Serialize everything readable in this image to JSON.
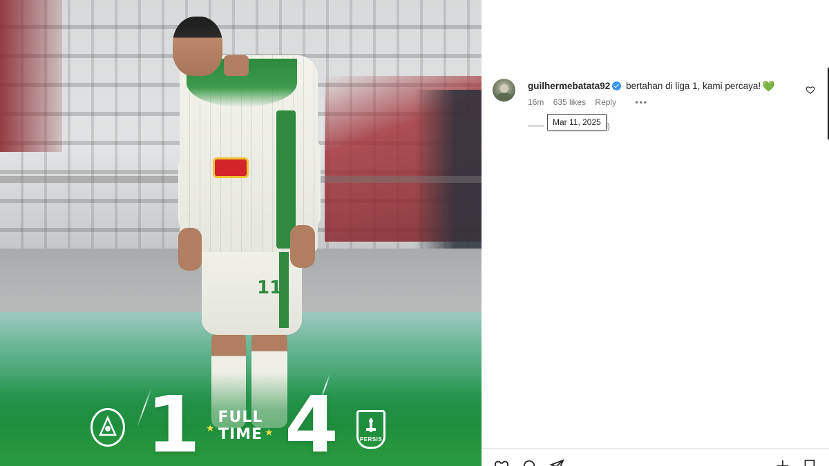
{
  "photo": {
    "score": {
      "home": "1",
      "away": "4",
      "status_line1": "FULL",
      "status_line2": "TIME"
    },
    "away_crest_label": "PERSIS",
    "player_number": "11"
  },
  "comment": {
    "username": "guilhermebatata92",
    "text": "bertahan di liga 1, kami percaya!",
    "emoji": "💚",
    "time_ago": "16m",
    "likes": "635 likes",
    "reply_label": "Reply",
    "more_label": "•••",
    "view_replies_count": "129)",
    "tooltip_date": "Mar 11, 2025"
  },
  "colors": {
    "verified": "#3897f0",
    "pitch_green": "#1c8b3f",
    "text_primary": "#262626",
    "text_secondary": "#737373"
  },
  "icons": {
    "comment_like": "heart-outline-icon",
    "actions": [
      "heart-outline-icon",
      "comment-bubble-icon",
      "share-send-icon",
      "save-bookmark-icon"
    ]
  }
}
